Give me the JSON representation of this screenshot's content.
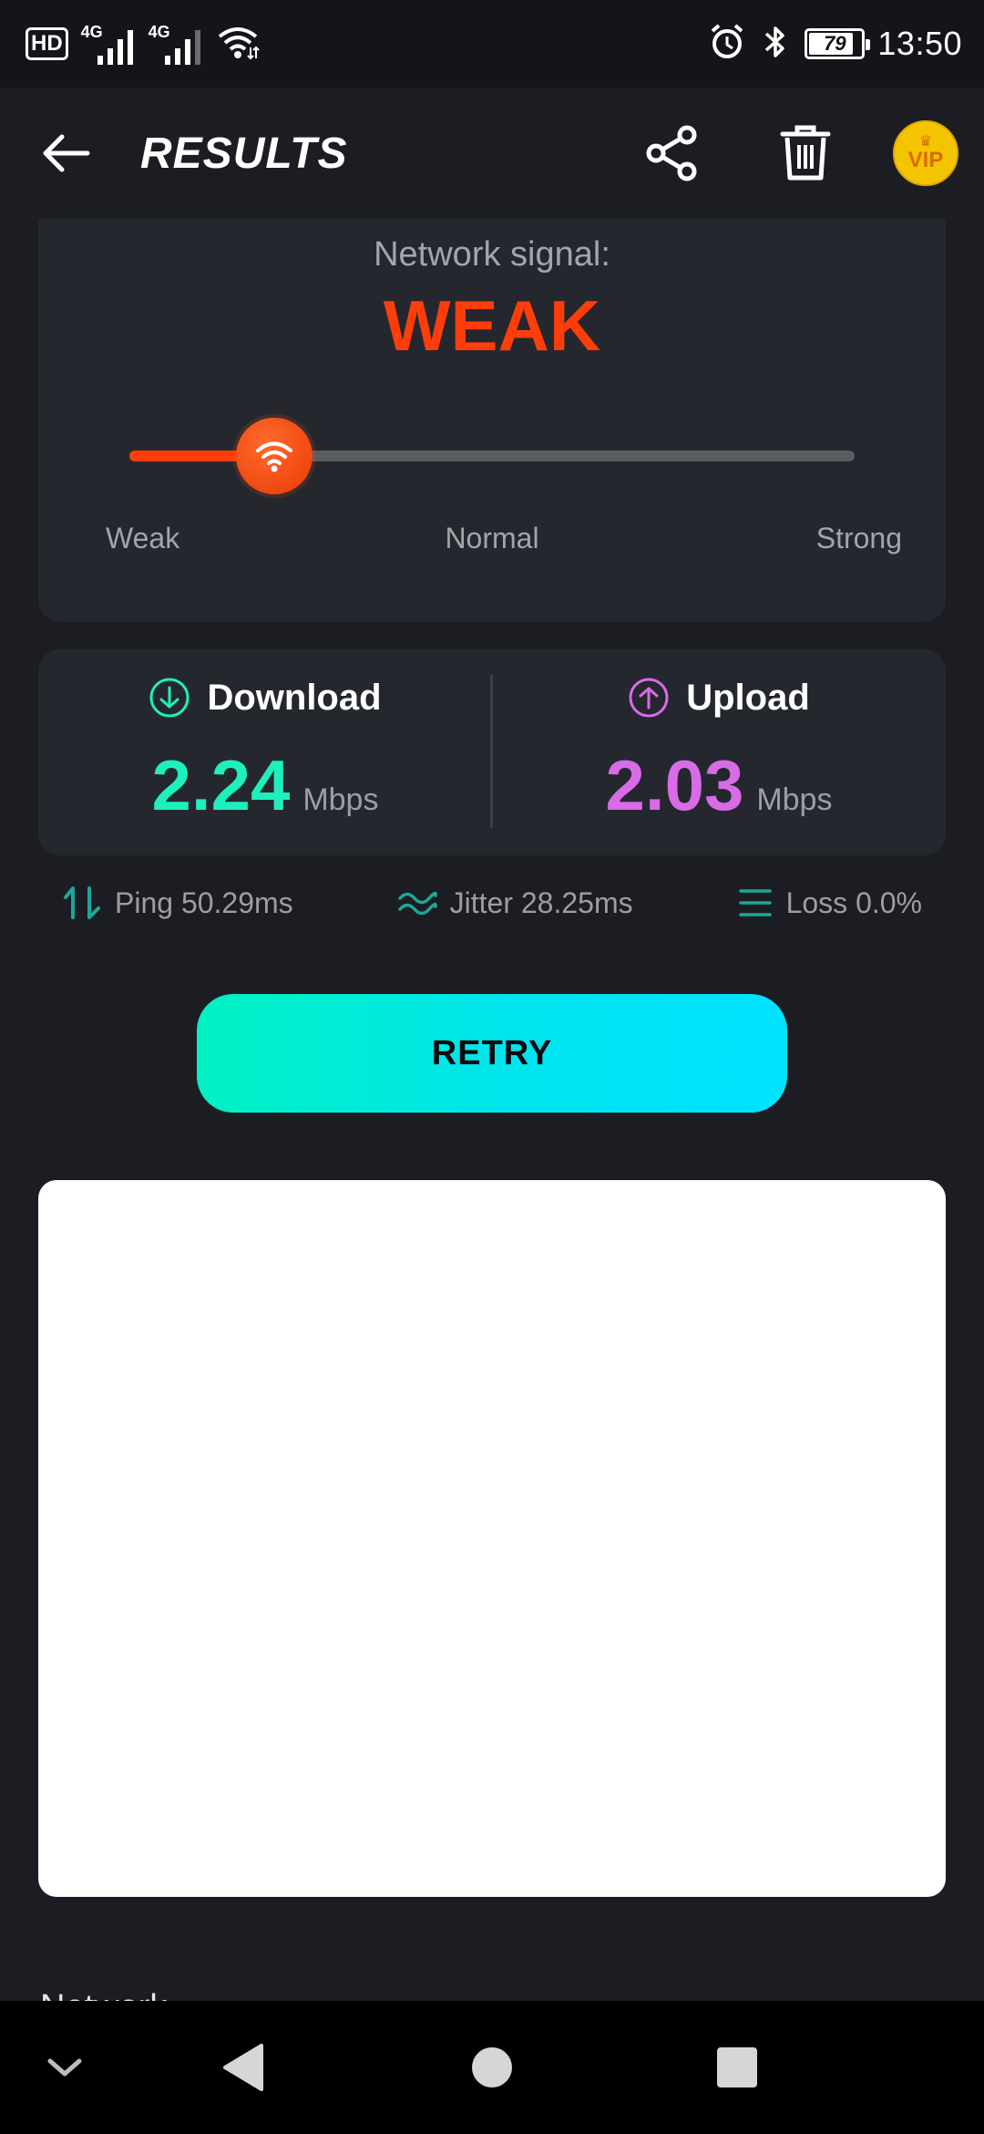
{
  "status_bar": {
    "hd_label": "HD",
    "network1_label": "4G",
    "network2_label": "4G",
    "battery_level": "79",
    "time": "13:50"
  },
  "app_bar": {
    "title": "RESULTS",
    "vip_label": "VIP"
  },
  "signal": {
    "label": "Network signal:",
    "value": "WEAK",
    "level_fraction": 0.2,
    "scale_labels": [
      "Weak",
      "Normal",
      "Strong"
    ],
    "accent_color": "#ff3d0a"
  },
  "speed": {
    "download": {
      "label": "Download",
      "value": "2.24",
      "unit": "Mbps",
      "color": "#1df0bd"
    },
    "upload": {
      "label": "Upload",
      "value": "2.03",
      "unit": "Mbps",
      "color": "#d86be6"
    }
  },
  "metrics": {
    "ping": "Ping 50.29ms",
    "jitter": "Jitter 28.25ms",
    "loss": "Loss 0.0%"
  },
  "retry_label": "RETRY",
  "section_peek": "Network"
}
